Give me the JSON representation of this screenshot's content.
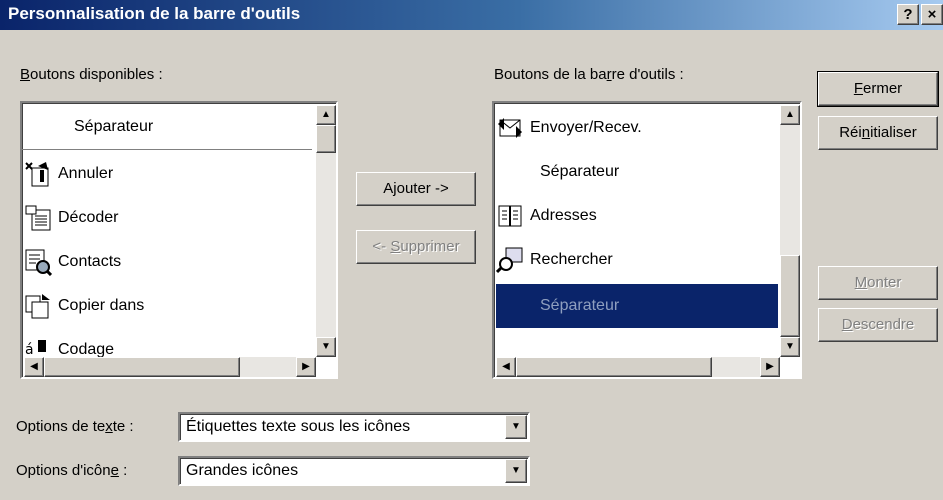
{
  "window": {
    "title": "Personnalisation de la barre d'outils",
    "help": "?",
    "close": "×"
  },
  "available": {
    "label_key": "B",
    "label_rest": "outons disponibles :",
    "items": [
      {
        "label": "Séparateur",
        "icon": "none"
      },
      {
        "label": "Annuler",
        "icon": "undo-icon"
      },
      {
        "label": "Décoder",
        "icon": "decode-icon"
      },
      {
        "label": "Contacts",
        "icon": "contacts-icon"
      },
      {
        "label": "Copier dans",
        "icon": "copy-to-folder-icon"
      },
      {
        "label": "Codage",
        "icon": "encoding-icon"
      }
    ]
  },
  "toolbar": {
    "label_pre": "Boutons de la ba",
    "label_key": "r",
    "label_rest": "re d'outils :",
    "items": [
      {
        "label": "Envoyer/Recev.",
        "icon": "send-receive-icon"
      },
      {
        "label": "Séparateur",
        "icon": "none"
      },
      {
        "label": "Adresses",
        "icon": "address-book-icon"
      },
      {
        "label": "Rechercher",
        "icon": "find-icon"
      },
      {
        "label": "Séparateur",
        "icon": "none",
        "selected": true
      }
    ]
  },
  "buttons": {
    "add_pre": "A",
    "add_key": "j",
    "add_rest": "outer ->",
    "remove_pre": "<- ",
    "remove_key": "S",
    "remove_rest": "upprimer",
    "close_key": "F",
    "close_rest": "ermer",
    "reset_pre": "Réi",
    "reset_key": "n",
    "reset_rest": "itialiser",
    "up_key": "M",
    "up_rest": "onter",
    "down_key": "D",
    "down_rest": "escendre"
  },
  "text_options": {
    "label_pre": "Options de te",
    "label_key": "x",
    "label_rest": "te :",
    "value": "Étiquettes texte sous les icônes"
  },
  "icon_options": {
    "label_pre": "Options d'icôn",
    "label_key": "e",
    "label_rest": " :",
    "value": "Grandes icônes"
  },
  "colors": {
    "title_start": "#0a246a",
    "title_end": "#a6caf0",
    "selection": "#0a246a",
    "face": "#d4d0c8"
  }
}
